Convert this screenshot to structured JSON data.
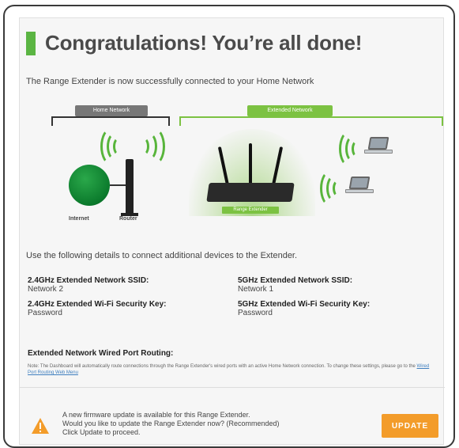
{
  "page": {
    "title": "Congratulations! You’re all done!",
    "intro": "The Range Extender is now successfully connected to your Home Network"
  },
  "diagram": {
    "home_network_label": "Home Network",
    "extended_network_label": "Extended Network",
    "internet_label": "Internet",
    "router_label": "Router",
    "extender_label": "Range Extender"
  },
  "details": {
    "instructions": "Use the following details to connect additional devices to the Extender.",
    "ssid_24_label": "2.4GHz Extended Network SSID:",
    "ssid_24_value": "Network 2",
    "ssid_5_label": "5GHz Extended Network SSID:",
    "ssid_5_value": "Network 1",
    "key_24_label": "2.4GHz Extended Wi-Fi Security Key:",
    "key_24_value": "Password",
    "key_5_label": "5GHz Extended Wi-Fi Security Key:",
    "key_5_value": "Password"
  },
  "routing": {
    "heading": "Extended Network Wired Port Routing:",
    "note": "Note: The Dashboard will automatically route connections through the Range Extender's wired ports with an active Home Network connection. To change these settings, please go to the",
    "link": "Wired Port Routing Web Menu"
  },
  "firmware": {
    "line1": "A new firmware update is available for this Range Extender.",
    "line2": "Would you like to update the Range Extender now? (Recommended)",
    "line3": "Click Update to proceed.",
    "button_label": "UPDATE"
  },
  "colors": {
    "accent_green": "#5bb543",
    "update_orange": "#f39c2a"
  }
}
